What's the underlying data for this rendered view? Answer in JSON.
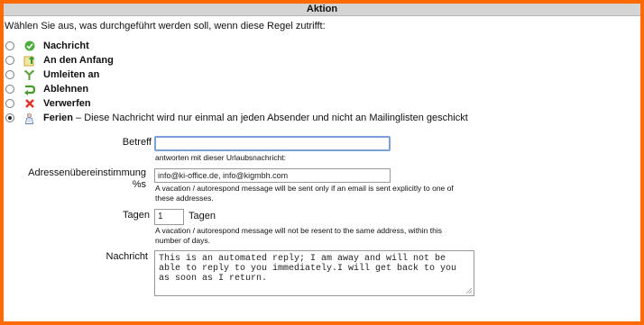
{
  "header": {
    "title": "Aktion"
  },
  "intro": "Wählen Sie aus, was durchgeführt werden soll, wenn diese Regel zutrifft:",
  "options": [
    {
      "label": "Nachricht",
      "desc": "",
      "icon": "check-icon",
      "checked": false
    },
    {
      "label": "An den Anfang",
      "desc": "",
      "icon": "arrow-up-icon",
      "checked": false
    },
    {
      "label": "Umleiten an",
      "desc": "",
      "icon": "redirect-icon",
      "checked": false
    },
    {
      "label": "Ablehnen",
      "desc": "",
      "icon": "reject-icon",
      "checked": false
    },
    {
      "label": "Verwerfen",
      "desc": "",
      "icon": "discard-icon",
      "checked": false
    },
    {
      "label": "Ferien",
      "desc": "– Diese Nachricht wird nur einmal an jeden Absender und nicht an Mailinglisten geschickt",
      "icon": "vacation-icon",
      "checked": true
    }
  ],
  "betreff": {
    "label": "Betreff",
    "value": "",
    "hint": "antworten mit dieser Urlaubsnachricht:"
  },
  "adressen": {
    "label_line1": "Adressenübereinstimmung",
    "label_line2": "%s",
    "value": "info@ki-office.de, info@kigmbh.com",
    "hint_line1": "A vacation / autorespond message will be sent only if an email is sent explicitly to one of",
    "hint_line2": "these addresses."
  },
  "tage": {
    "label": "Tagen",
    "value": "1",
    "suffix": "Tagen",
    "hint_line1": "A vacation / autorespond message will not be resent to the same address, within this",
    "hint_line2": "number of days."
  },
  "nachricht": {
    "label": "Nachricht",
    "value": "This is an automated reply; I am away and will not be able to reply to you immediately.I will get back to you as soon as I return."
  },
  "colors": {
    "frame": "#ff6a00",
    "focus": "#7aa0d6"
  }
}
